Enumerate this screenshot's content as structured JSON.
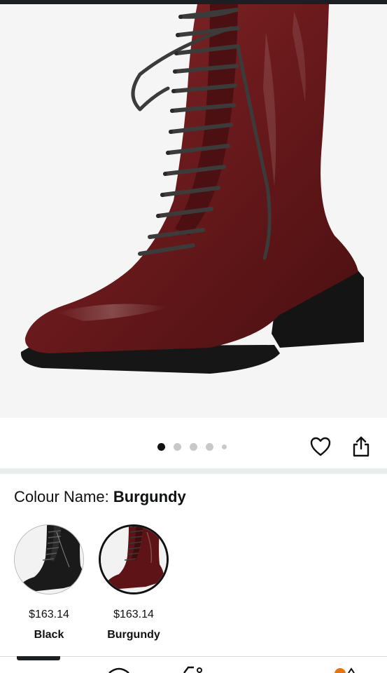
{
  "product": {
    "image_alt": "Burgundy patent leather lace-up ankle boot",
    "gallery": {
      "count": 5,
      "active_index": 0
    }
  },
  "actions": {
    "wishlist_icon": "heart-icon",
    "share_icon": "share-icon"
  },
  "colour": {
    "label": "Colour Name: ",
    "selected": "Burgundy",
    "options": [
      {
        "name": "Black",
        "price": "$163.14",
        "selected": false,
        "swatch_color": "#1a1a1a"
      },
      {
        "name": "Burgundy",
        "price": "$163.14",
        "selected": true,
        "swatch_color": "#5e1416"
      }
    ]
  },
  "colors": {
    "boot": "#6b1a1c",
    "sole": "#161616",
    "laces": "#3b3b3b",
    "background": "#f5f5f5"
  }
}
